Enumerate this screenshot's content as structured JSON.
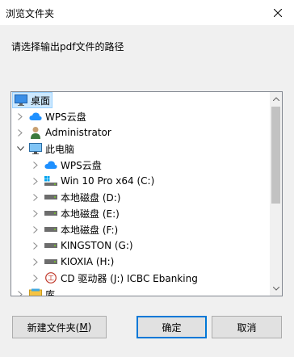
{
  "window": {
    "title": "浏览文件夹"
  },
  "instruction": "请选择输出pdf文件的路径",
  "tree": [
    {
      "label": "桌面",
      "icon": "desktop-icon",
      "expander": "",
      "indent": 0,
      "selected": true
    },
    {
      "label": "WPS云盘",
      "icon": "cloud-icon",
      "expander": ">",
      "indent": 1,
      "selected": false
    },
    {
      "label": "Administrator",
      "icon": "user-icon",
      "expander": ">",
      "indent": 1,
      "selected": false
    },
    {
      "label": "此电脑",
      "icon": "computer-icon",
      "expander": "v",
      "indent": 1,
      "selected": false
    },
    {
      "label": "WPS云盘",
      "icon": "cloud-icon",
      "expander": ">",
      "indent": 2,
      "selected": false
    },
    {
      "label": "Win 10 Pro x64 (C:)",
      "icon": "system-drive-icon",
      "expander": ">",
      "indent": 2,
      "selected": false
    },
    {
      "label": "本地磁盘 (D:)",
      "icon": "drive-icon",
      "expander": ">",
      "indent": 2,
      "selected": false
    },
    {
      "label": "本地磁盘 (E:)",
      "icon": "drive-icon",
      "expander": ">",
      "indent": 2,
      "selected": false
    },
    {
      "label": "本地磁盘 (F:)",
      "icon": "drive-icon",
      "expander": ">",
      "indent": 2,
      "selected": false
    },
    {
      "label": "KINGSTON (G:)",
      "icon": "drive-icon",
      "expander": ">",
      "indent": 2,
      "selected": false
    },
    {
      "label": "KIOXIA (H:)",
      "icon": "drive-icon",
      "expander": ">",
      "indent": 2,
      "selected": false
    },
    {
      "label": "CD 驱动器 (J:) ICBC Ebanking",
      "icon": "cd-drive-icon",
      "expander": ">",
      "indent": 2,
      "selected": false
    },
    {
      "label": "库",
      "icon": "library-icon",
      "expander": ">",
      "indent": 1,
      "selected": false
    }
  ],
  "buttons": {
    "new_folder_prefix": "新建文件夹(",
    "new_folder_key": "M",
    "new_folder_suffix": ")",
    "ok": "确定",
    "cancel": "取消"
  },
  "colors": {
    "accent": "#0078d7",
    "selection_bg": "#cce8ff",
    "selection_border": "#99d1ff",
    "dialog_bg": "#f0f0f0"
  }
}
